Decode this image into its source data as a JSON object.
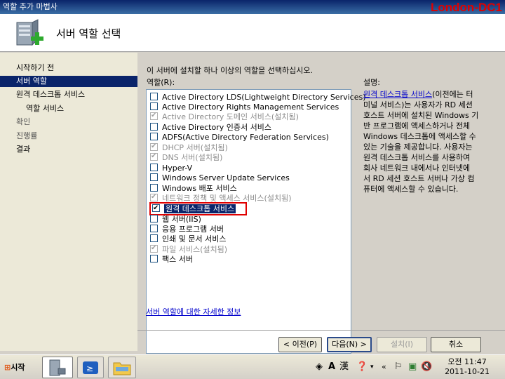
{
  "window": {
    "title": "역할 추가 마법사",
    "machine_name": "London-DC1"
  },
  "header": {
    "title": "서버 역할 선택"
  },
  "nav": {
    "items": [
      {
        "label": "시작하기 전",
        "state": "normal"
      },
      {
        "label": "서버 역할",
        "state": "active"
      },
      {
        "label": "원격 데스크톱 서비스",
        "state": "normal"
      },
      {
        "label": "역할 서비스",
        "state": "normal"
      },
      {
        "label": "확인",
        "state": "dim"
      },
      {
        "label": "진행률",
        "state": "dim"
      },
      {
        "label": "결과",
        "state": "normal"
      }
    ]
  },
  "main": {
    "instruction": "이 서버에 설치할 하나 이상의 역할을 선택하십시오.",
    "roles_label": "역할(R):",
    "description_label": "설명:",
    "roles": [
      {
        "label": "Active Directory LDS(Lightweight Directory Services)",
        "checked": false,
        "disabled": false
      },
      {
        "label": "Active Directory Rights Management Services",
        "checked": false,
        "disabled": false
      },
      {
        "label": "Active Directory 도메인 서비스(설치됨)",
        "checked": true,
        "disabled": true
      },
      {
        "label": "Active Directory 인증서 서비스",
        "checked": false,
        "disabled": false
      },
      {
        "label": "ADFS(Active Directory Federation Services)",
        "checked": false,
        "disabled": false
      },
      {
        "label": "DHCP 서버(설치됨)",
        "checked": true,
        "disabled": true
      },
      {
        "label": "DNS 서버(설치됨)",
        "checked": true,
        "disabled": true
      },
      {
        "label": "Hyper-V",
        "checked": false,
        "disabled": false
      },
      {
        "label": "Windows Server Update Services",
        "checked": false,
        "disabled": false
      },
      {
        "label": "Windows 배포 서비스",
        "checked": false,
        "disabled": false
      },
      {
        "label": "네트워크 정책 및 액세스 서비스(설치됨)",
        "checked": true,
        "disabled": true
      },
      {
        "label": "원격 데스크톱 서비스",
        "checked": true,
        "disabled": false,
        "selected": true
      },
      {
        "label": "웹 서버(IIS)",
        "checked": false,
        "disabled": false
      },
      {
        "label": "응용 프로그램 서버",
        "checked": false,
        "disabled": false
      },
      {
        "label": "인쇄 및 문서 서비스",
        "checked": false,
        "disabled": false
      },
      {
        "label": "파일 서비스(설치됨)",
        "checked": true,
        "disabled": true
      },
      {
        "label": "팩스 서버",
        "checked": false,
        "disabled": false
      }
    ],
    "description": {
      "link_text": "원격 데스크톱 서비스",
      "lines": [
        "(이전에는 터",
        "미널 서비스)는 사용자가 RD 세션",
        "호스트 서버에 설치된 Windows 기",
        "반 프로그램에 액세스하거나 전체",
        "Windows 데스크톱에 액세스할 수",
        "있는 기술을 제공합니다. 사용자는",
        "원격 데스크톱 서비스를 사용하여",
        "회사 네트워크 내에서나 인터넷에",
        "서 RD 세션 호스트 서버나 가상 컴",
        "퓨터에 액세스할 수 있습니다."
      ]
    },
    "more_info_link": "서버 역할에 대한 자세한 정보"
  },
  "buttons": {
    "prev": "< 이전(P)",
    "next": "다음(N) >",
    "install": "설치(I)",
    "cancel": "취소"
  },
  "taskbar": {
    "start_label": "시작",
    "ime_a": "A",
    "ime_han": "漢",
    "time": "오전 11:47",
    "date": "2011-10-21"
  },
  "colors": {
    "selection": "#0a246a",
    "highlight_border": "#e00000",
    "link": "#0000cc",
    "machine_name": "#e00000"
  }
}
